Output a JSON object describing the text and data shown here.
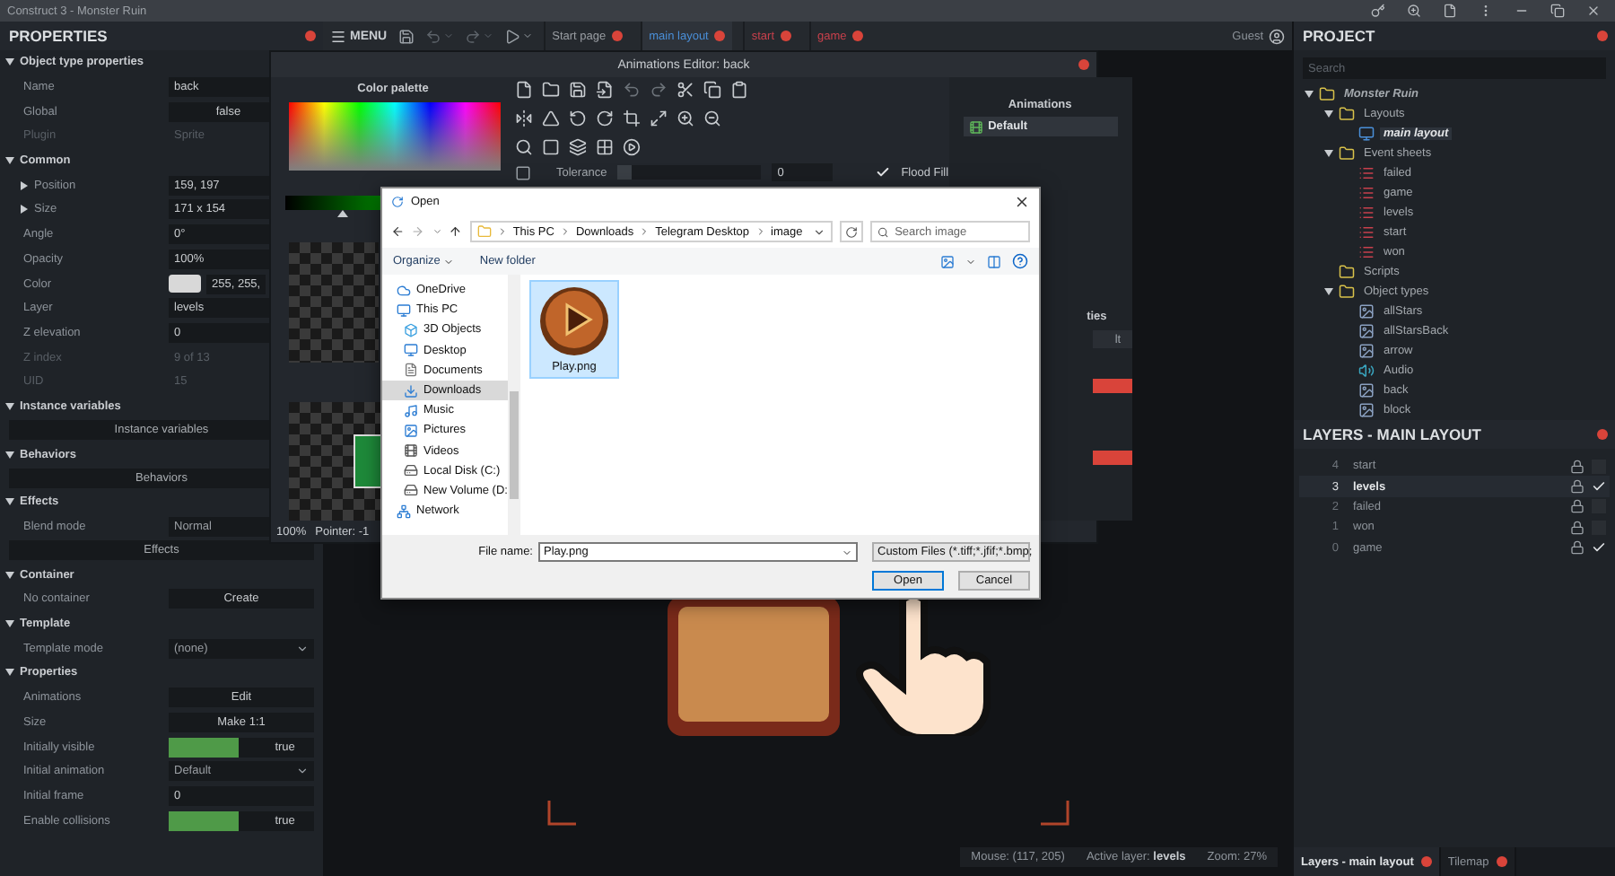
{
  "window": {
    "title": "Construct 3 - Monster Ruin"
  },
  "toolbar": {
    "menu_label": "MENU",
    "user": "Guest",
    "tabs": [
      {
        "label": "Start page",
        "selected": false,
        "color": "#9a9ea3"
      },
      {
        "label": "main layout",
        "selected": true,
        "color": "#4a8fd8"
      },
      {
        "label": "start",
        "selected": false,
        "color": "#c8404c"
      },
      {
        "label": "game",
        "selected": false,
        "color": "#c8404c"
      }
    ]
  },
  "properties": {
    "title": "PROPERTIES",
    "sections": [
      {
        "title": "Object type properties",
        "expanded": true,
        "rows": [
          {
            "kind": "field",
            "label": "Name",
            "value": "back"
          },
          {
            "kind": "toggle",
            "label": "Global",
            "value": "false",
            "on": false
          },
          {
            "kind": "readonly",
            "label": "Plugin",
            "value": "Sprite"
          }
        ]
      },
      {
        "title": "Common",
        "expanded": true,
        "rows": [
          {
            "kind": "group",
            "label": "Position",
            "value": "159, 197",
            "expanded": false
          },
          {
            "kind": "group",
            "label": "Size",
            "value": "171 x 154",
            "expanded": false
          },
          {
            "kind": "field",
            "label": "Angle",
            "value": "0°"
          },
          {
            "kind": "field",
            "label": "Opacity",
            "value": "100%"
          },
          {
            "kind": "color",
            "label": "Color",
            "value": "255, 255,",
            "color": "#d8d8d8"
          },
          {
            "kind": "field",
            "label": "Layer",
            "value": "levels"
          },
          {
            "kind": "field",
            "label": "Z elevation",
            "value": "0"
          },
          {
            "kind": "readonly",
            "label": "Z index",
            "value": "9 of 13"
          },
          {
            "kind": "readonly",
            "label": "UID",
            "value": "15"
          }
        ]
      },
      {
        "title": "Instance variables",
        "expanded": true,
        "rows": [
          {
            "kind": "wide_button",
            "label": "Instance variables"
          }
        ]
      },
      {
        "title": "Behaviors",
        "expanded": true,
        "rows": [
          {
            "kind": "wide_button",
            "label": "Behaviors"
          }
        ]
      },
      {
        "title": "Effects",
        "expanded": true,
        "rows": [
          {
            "kind": "select",
            "label": "Blend mode",
            "value": "Normal"
          },
          {
            "kind": "wide_button",
            "label": "Effects"
          }
        ]
      },
      {
        "title": "Container",
        "expanded": true,
        "rows": [
          {
            "kind": "button",
            "label": "No container",
            "value": "Create"
          }
        ]
      },
      {
        "title": "Template",
        "expanded": true,
        "rows": [
          {
            "kind": "select",
            "label": "Template mode",
            "value": "(none)"
          }
        ]
      },
      {
        "title": "Properties",
        "expanded": true,
        "rows": [
          {
            "kind": "button",
            "label": "Animations",
            "value": "Edit"
          },
          {
            "kind": "button",
            "label": "Size",
            "value": "Make 1:1"
          },
          {
            "kind": "toggle",
            "label": "Initially visible",
            "value": "true",
            "on": true
          },
          {
            "kind": "select",
            "label": "Initial animation",
            "value": "Default"
          },
          {
            "kind": "field",
            "label": "Initial frame",
            "value": "0"
          },
          {
            "kind": "toggle",
            "label": "Enable collisions",
            "value": "true",
            "on": true
          }
        ]
      }
    ]
  },
  "animations_editor": {
    "title": "Animations Editor: back",
    "palette_title": "Color palette",
    "zoom": "100%",
    "pointer": "Pointer: -1",
    "shade_slider": {
      "level": 0.27
    },
    "tolerance": {
      "label": "Tolerance",
      "value": "0",
      "level": 0
    },
    "flood_fill": {
      "label": "Flood Fill",
      "checked": true
    },
    "animations_title": "Animations",
    "animations": [
      {
        "name": "Default",
        "selected": true
      }
    ],
    "properties_fragment": {
      "title": "ties",
      "value": "lt"
    }
  },
  "open_dialog": {
    "title": "Open",
    "path": [
      "This PC",
      "Downloads",
      "Telegram Desktop",
      "image"
    ],
    "search": {
      "placeholder": "Search image"
    },
    "organize": "Organize",
    "new_folder": "New folder",
    "nav": [
      {
        "label": "OneDrive",
        "kind": "cloud",
        "selected": false
      },
      {
        "label": "This PC",
        "kind": "pc",
        "selected": false,
        "children": [
          {
            "label": "3D Objects",
            "kind": "objects3d",
            "selected": false
          },
          {
            "label": "Desktop",
            "kind": "desktop",
            "selected": false
          },
          {
            "label": "Documents",
            "kind": "documents",
            "selected": false
          },
          {
            "label": "Downloads",
            "kind": "downloads",
            "selected": true
          },
          {
            "label": "Music",
            "kind": "music",
            "selected": false
          },
          {
            "label": "Pictures",
            "kind": "pictures",
            "selected": false
          },
          {
            "label": "Videos",
            "kind": "videos",
            "selected": false
          },
          {
            "label": "Local Disk (C:)",
            "kind": "disk",
            "selected": false
          },
          {
            "label": "New Volume (D:",
            "kind": "disk",
            "selected": false
          }
        ]
      },
      {
        "label": "Network",
        "kind": "network",
        "selected": false
      }
    ],
    "files": [
      {
        "name": "Play.png",
        "selected": true
      }
    ],
    "file_name": {
      "label": "File name:",
      "value": "Play.png"
    },
    "file_type": "Custom Files (*.tiff;*.jfif;*.bmp;",
    "buttons": [
      {
        "label": "Open",
        "default": true
      },
      {
        "label": "Cancel",
        "default": false
      }
    ]
  },
  "project": {
    "title": "PROJECT",
    "search": {
      "placeholder": "Search"
    },
    "tree": [
      {
        "label": "Monster Ruin",
        "kind": "folder",
        "expanded": true,
        "selected": false,
        "children": [
          {
            "label": "Layouts",
            "kind": "folder",
            "expanded": true,
            "selected": false,
            "children": [
              {
                "label": "main layout",
                "kind": "layout",
                "selected": true
              }
            ]
          },
          {
            "label": "Event sheets",
            "kind": "folder",
            "expanded": true,
            "selected": false,
            "children": [
              {
                "label": "failed",
                "kind": "event_sheet",
                "selected": false
              },
              {
                "label": "game",
                "kind": "event_sheet",
                "selected": false
              },
              {
                "label": "levels",
                "kind": "event_sheet",
                "selected": false
              },
              {
                "label": "start",
                "kind": "event_sheet",
                "selected": false
              },
              {
                "label": "won",
                "kind": "event_sheet",
                "selected": false
              }
            ]
          },
          {
            "label": "Scripts",
            "kind": "folder",
            "selected": false
          },
          {
            "label": "Object types",
            "kind": "folder",
            "expanded": true,
            "selected": false,
            "children": [
              {
                "label": "allStars",
                "kind": "sprite",
                "selected": false
              },
              {
                "label": "allStarsBack",
                "kind": "sprite",
                "selected": false
              },
              {
                "label": "arrow",
                "kind": "sprite",
                "selected": false
              },
              {
                "label": "Audio",
                "kind": "audio",
                "selected": false
              },
              {
                "label": "back",
                "kind": "sprite",
                "selected": false
              },
              {
                "label": "block",
                "kind": "sprite",
                "selected": false
              }
            ]
          }
        ]
      }
    ]
  },
  "layers": {
    "title": "LAYERS - MAIN LAYOUT",
    "rows": [
      {
        "index": "4",
        "name": "start",
        "selected": false,
        "visible": false
      },
      {
        "index": "3",
        "name": "levels",
        "selected": true,
        "visible": true
      },
      {
        "index": "2",
        "name": "failed",
        "selected": false,
        "visible": false
      },
      {
        "index": "1",
        "name": "won",
        "selected": false,
        "visible": false
      },
      {
        "index": "0",
        "name": "game",
        "selected": false,
        "visible": true
      }
    ]
  },
  "bottom_tabs": [
    {
      "label": "Layers - main layout",
      "selected": true
    },
    {
      "label": "Tilemap",
      "selected": false
    }
  ],
  "status_bar": {
    "mouse": "Mouse: (117, 205)",
    "active_layer": "Active layer: **levels**",
    "zoom": "Zoom: 27%"
  }
}
